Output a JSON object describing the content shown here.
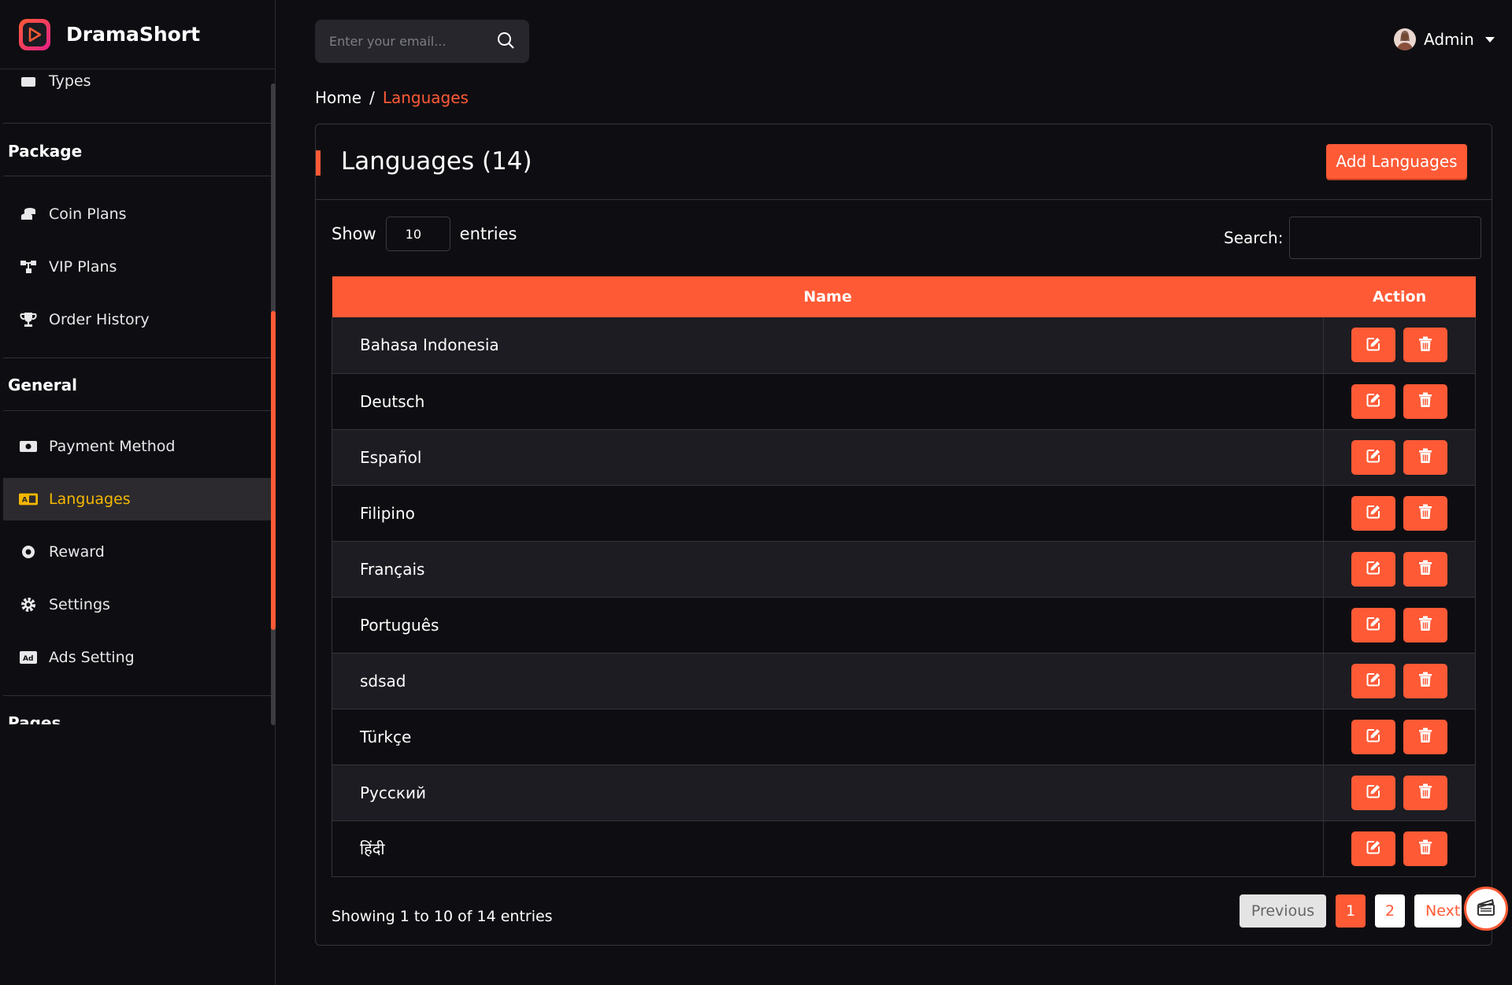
{
  "app": {
    "name": "DramaShort"
  },
  "search": {
    "placeholder": "Enter your email..."
  },
  "user": {
    "name": "Admin"
  },
  "sidebar": {
    "partial_item": "Types",
    "sections": [
      {
        "title": "Package"
      },
      {
        "title": "General"
      },
      {
        "title": "Pages"
      }
    ],
    "items": [
      {
        "label": "Coin Plans",
        "icon": "coins-icon"
      },
      {
        "label": "VIP Plans",
        "icon": "sitemap-icon"
      },
      {
        "label": "Order History",
        "icon": "trophy-icon"
      },
      {
        "label": "Payment Method",
        "icon": "money-icon"
      },
      {
        "label": "Languages",
        "icon": "language-icon",
        "active": true
      },
      {
        "label": "Reward",
        "icon": "gear-badge-icon"
      },
      {
        "label": "Settings",
        "icon": "gear-icon"
      },
      {
        "label": "Ads Setting",
        "icon": "ad-icon"
      }
    ]
  },
  "breadcrumb": {
    "home": "Home",
    "sep": "/",
    "current": "Languages"
  },
  "card": {
    "title": "Languages (14)",
    "add_button": "Add Languages",
    "show_label": "Show",
    "entries_value": "10",
    "entries_label": "entries",
    "search_label": "Search:"
  },
  "table": {
    "columns": [
      "Name",
      "Action"
    ],
    "rows": [
      "Bahasa Indonesia",
      "Deutsch",
      "Español",
      "Filipino",
      "Français",
      "Português",
      "sdsad",
      "Türkçe",
      "Русский",
      "हिंदी"
    ]
  },
  "footer": {
    "info": "Showing 1 to 10 of 14 entries",
    "previous": "Previous",
    "pages": [
      "1",
      "2"
    ],
    "next": "Next"
  },
  "colors": {
    "accent": "#ff5a36",
    "background": "#0e0e12",
    "active_text": "#f5b800"
  }
}
